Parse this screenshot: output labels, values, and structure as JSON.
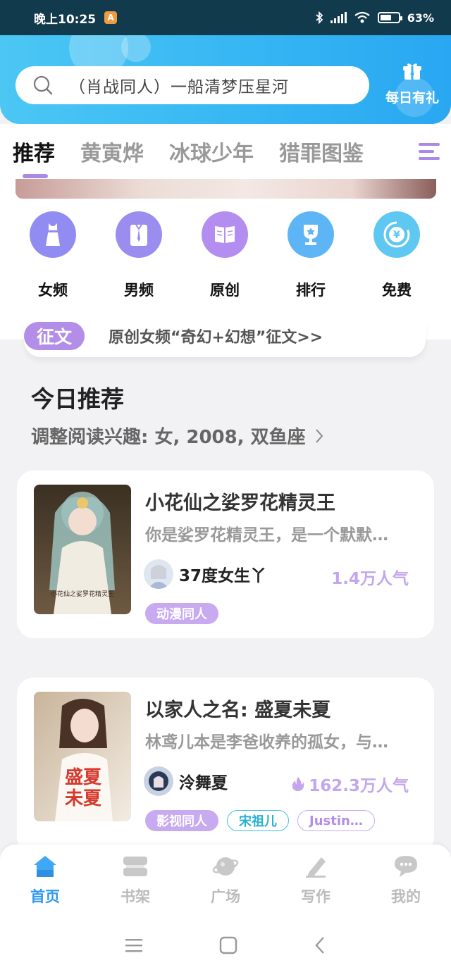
{
  "status_bar": {
    "time": "晚上10:25",
    "battery": "63%",
    "battery_level": 0.63
  },
  "header": {
    "search_placeholder": "（肖战同人）一船清梦压星河",
    "daily_gift_label": "每日有礼",
    "accent_color": "#36b6f3"
  },
  "tabs": [
    {
      "label": "推荐",
      "active": true
    },
    {
      "label": "黄寅烨",
      "active": false
    },
    {
      "label": "冰球少年",
      "active": false
    },
    {
      "label": "猎罪图鉴",
      "active": false
    }
  ],
  "categories": [
    {
      "label": "女频",
      "icon": "dress-icon",
      "color": "#8f8cf0"
    },
    {
      "label": "男频",
      "icon": "shirt-icon",
      "color": "#9a8af0"
    },
    {
      "label": "原创",
      "icon": "book-icon",
      "color": "#b08cf0"
    },
    {
      "label": "排行",
      "icon": "trophy-icon",
      "color": "#5cb4f4"
    },
    {
      "label": "免费",
      "icon": "yuan-coin-icon",
      "color": "#5cc6f2"
    }
  ],
  "contest": {
    "tag": "征文",
    "text": "原创女频“奇幻+幻想”征文>>"
  },
  "recommend": {
    "title": "今日推荐",
    "subtitle": "调整阅读兴趣: 女, 2008, 双鱼座"
  },
  "books": [
    {
      "title": "小花仙之娑罗花精灵王",
      "desc": "你是娑罗花精灵王，是一个默默…",
      "author": "37度女生丫",
      "popularity": "1.4万人气",
      "hot": false,
      "tags": [
        {
          "label": "动漫同人",
          "style": "p"
        }
      ]
    },
    {
      "title": "以家人之名: 盛夏未夏",
      "desc": "林鸢儿本是李爸收养的孤女，与…",
      "author": "泠舞夏",
      "popularity": "162.3万人气",
      "hot": true,
      "cover_text": "盛夏未夏",
      "tags": [
        {
          "label": "影视同人",
          "style": "p"
        },
        {
          "label": "宋祖儿",
          "style": "b"
        },
        {
          "label": "Justin…",
          "style": "o"
        }
      ]
    }
  ],
  "bottom_nav": [
    {
      "label": "首页",
      "icon": "home-icon",
      "active": true
    },
    {
      "label": "书架",
      "icon": "bookshelf-icon",
      "active": false
    },
    {
      "label": "广场",
      "icon": "planet-icon",
      "active": false
    },
    {
      "label": "写作",
      "icon": "pen-icon",
      "active": false
    },
    {
      "label": "我的",
      "icon": "chat-bubble-icon",
      "active": false
    }
  ]
}
